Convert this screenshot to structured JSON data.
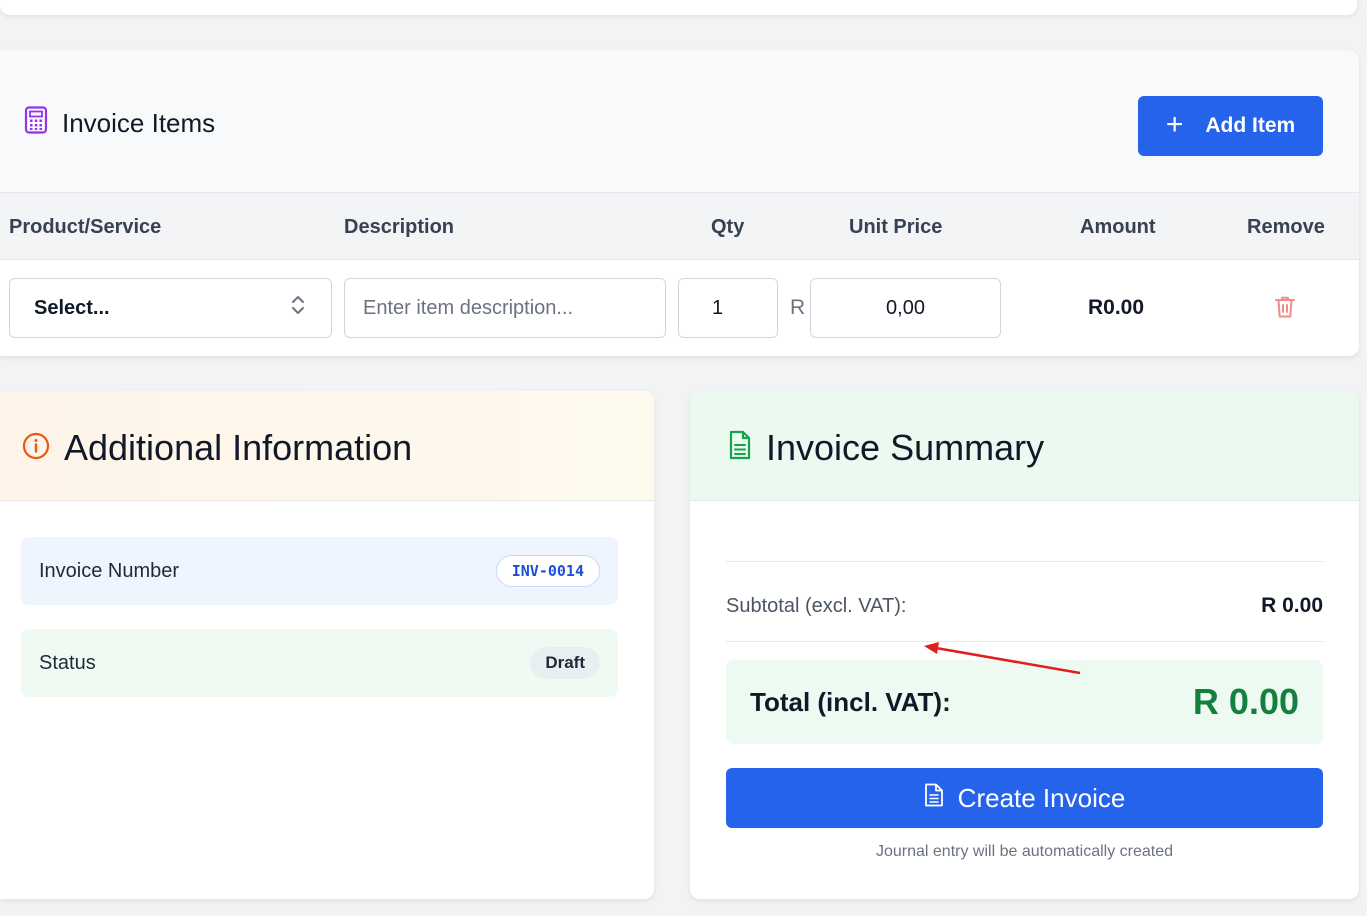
{
  "items": {
    "title": "Invoice Items",
    "add_label": "Add Item",
    "add_icon": "+",
    "columns": [
      "Product/Service",
      "Description",
      "Qty",
      "Unit Price",
      "Amount",
      "Remove"
    ],
    "row": {
      "product": "Select...",
      "description_placeholder": "Enter item description...",
      "qty": "1",
      "currency_symbol": "R",
      "unit_price": "0,00",
      "amount": "R0.00"
    }
  },
  "additional": {
    "title": "Additional Information",
    "invoice_number_label": "Invoice Number",
    "invoice_number": "INV-0014",
    "status_label": "Status",
    "status": "Draft"
  },
  "summary": {
    "title": "Invoice Summary",
    "subtotal_label": "Subtotal (excl. VAT):",
    "subtotal_value": "R 0.00",
    "total_label": "Total (incl. VAT):",
    "total_value": "R 0.00",
    "create_label": "Create Invoice",
    "note": "Journal entry will be automatically created"
  },
  "colors": {
    "primary": "#2563eb",
    "total_green": "#15803d",
    "calculator_icon": "#9333ea",
    "info_icon": "#ea580c",
    "doc_icon": "#16a34a",
    "annotation_arrow": "#e11d1d"
  }
}
